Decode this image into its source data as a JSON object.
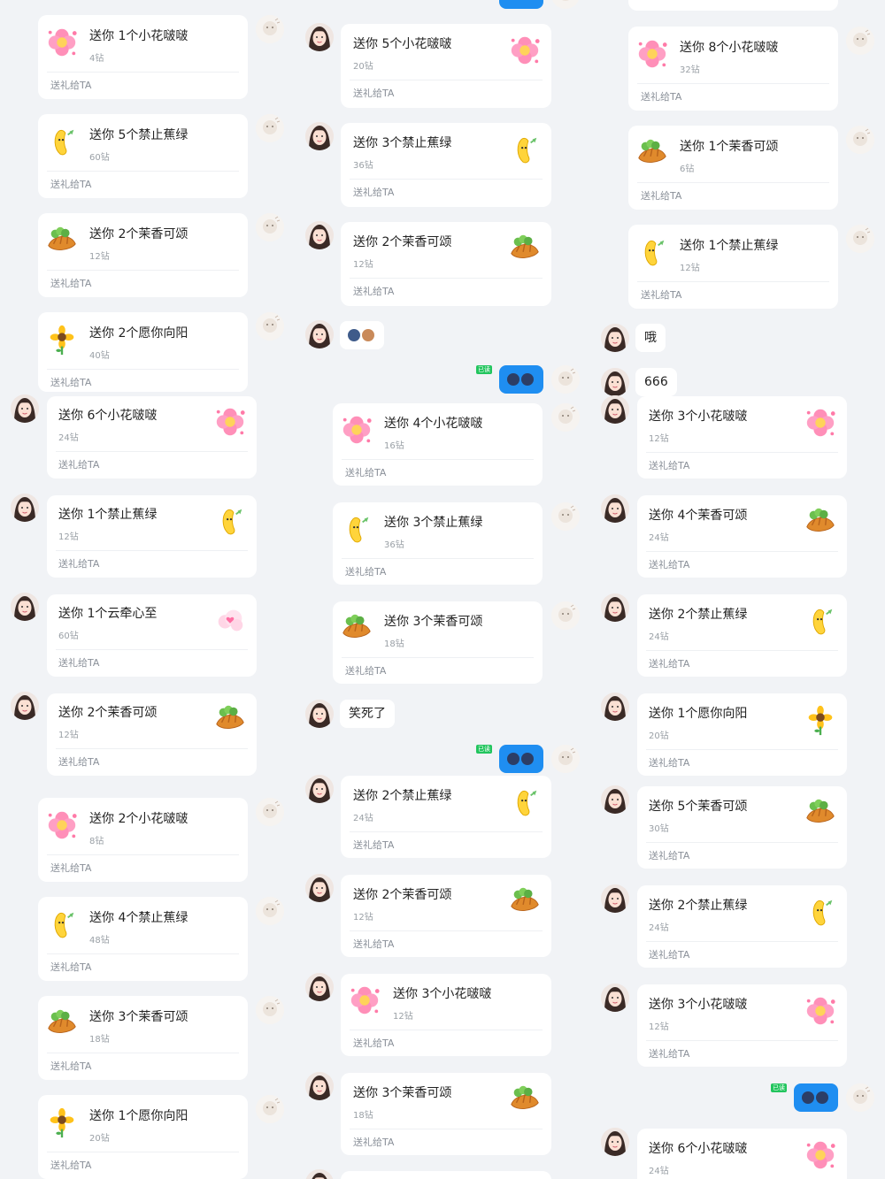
{
  "labels": {
    "send_to_ta": "送礼给TA",
    "read_badge": "已读"
  },
  "col1": [
    {
      "title": "送你 1个小花啵啵",
      "price": "4钻",
      "gift": "flower"
    },
    {
      "title": "送你 5个禁止蕉绿",
      "price": "60钻",
      "gift": "banana"
    },
    {
      "title": "送你 2个茉香可颂",
      "price": "12钻",
      "gift": "croissant"
    },
    {
      "title": "送你 2个愿你向阳",
      "price": "40钻",
      "gift": "sunflower"
    },
    {
      "title": "送你 6个小花啵啵",
      "price": "24钻",
      "gift": "flower"
    },
    {
      "title": "送你 1个禁止蕉绿",
      "price": "12钻",
      "gift": "banana"
    },
    {
      "title": "送你 1个云牵心至",
      "price": "60钻",
      "gift": "cloud"
    },
    {
      "title": "送你 2个茉香可颂",
      "price": "12钻",
      "gift": "croissant"
    },
    {
      "title": "送你 2个小花啵啵",
      "price": "8钻",
      "gift": "flower"
    },
    {
      "title": "送你 4个禁止蕉绿",
      "price": "48钻",
      "gift": "banana"
    },
    {
      "title": "送你 3个茉香可颂",
      "price": "18钻",
      "gift": "croissant"
    },
    {
      "title": "送你 1个愿你向阳",
      "price": "20钻",
      "gift": "sunflower"
    }
  ],
  "col2": [
    {
      "title": "送你 5个小花啵啵",
      "price": "20钻",
      "gift": "flower"
    },
    {
      "title": "送你 3个禁止蕉绿",
      "price": "36钻",
      "gift": "banana"
    },
    {
      "title": "送你 2个茉香可颂",
      "price": "12钻",
      "gift": "croissant"
    },
    {
      "title": "送你 4个小花啵啵",
      "price": "16钻",
      "gift": "flower"
    },
    {
      "title": "送你 3个禁止蕉绿",
      "price": "36钻",
      "gift": "banana"
    },
    {
      "title": "送你 3个茉香可颂",
      "price": "18钻",
      "gift": "croissant"
    },
    {
      "title": "送你 2个禁止蕉绿",
      "price": "24钻",
      "gift": "banana"
    },
    {
      "title": "送你 2个茉香可颂",
      "price": "12钻",
      "gift": "croissant"
    },
    {
      "title": "送你 3个小花啵啵",
      "price": "12钻",
      "gift": "flower"
    },
    {
      "title": "送你 3个茉香可颂",
      "price": "18钻",
      "gift": "croissant"
    }
  ],
  "col2_messages": {
    "laugh": "笑死了"
  },
  "col3": [
    {
      "title": "送你 8个小花啵啵",
      "price": "32钻",
      "gift": "flower"
    },
    {
      "title": "送你 1个茉香可颂",
      "price": "6钻",
      "gift": "croissant"
    },
    {
      "title": "送你 1个禁止蕉绿",
      "price": "12钻",
      "gift": "banana"
    },
    {
      "title": "送你 3个小花啵啵",
      "price": "12钻",
      "gift": "flower"
    },
    {
      "title": "送你 4个茉香可颂",
      "price": "24钻",
      "gift": "croissant"
    },
    {
      "title": "送你 2个禁止蕉绿",
      "price": "24钻",
      "gift": "banana"
    },
    {
      "title": "送你 1个愿你向阳",
      "price": "20钻",
      "gift": "sunflower"
    },
    {
      "title": "送你 5个茉香可颂",
      "price": "30钻",
      "gift": "croissant"
    },
    {
      "title": "送你 2个禁止蕉绿",
      "price": "24钻",
      "gift": "banana"
    },
    {
      "title": "送你 3个小花啵啵",
      "price": "12钻",
      "gift": "flower"
    },
    {
      "title": "送你 6个小花啵啵",
      "price": "24钻",
      "gift": "flower"
    }
  ],
  "col3_messages": {
    "oh": "哦",
    "num": "666"
  },
  "icons": {
    "flower": "flower-gift-icon",
    "banana": "banana-gift-icon",
    "croissant": "croissant-gift-icon",
    "sunflower": "sunflower-gift-icon",
    "cloud": "cloud-gift-icon"
  }
}
